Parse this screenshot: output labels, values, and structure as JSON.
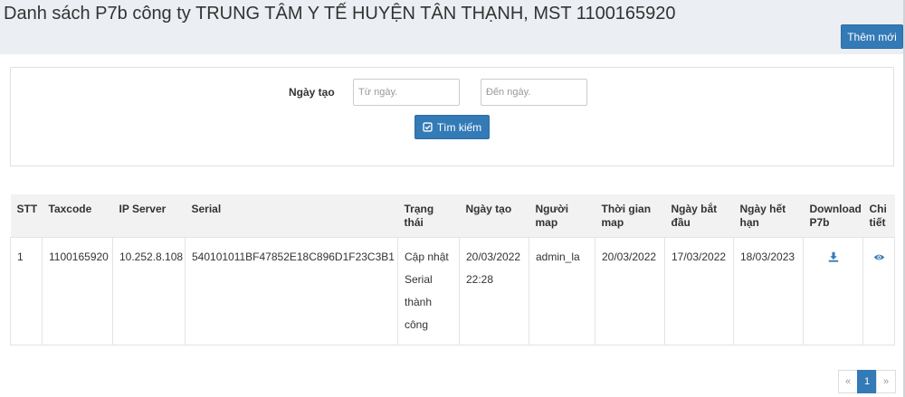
{
  "header": {
    "title": "Danh sách P7b công ty TRUNG TÂM Y TẾ HUYỆN TÂN THẠNH, MST 1100165920",
    "add_button": "Thêm mới"
  },
  "filter": {
    "label": "Ngày tạo",
    "from_placeholder": "Từ ngày.",
    "to_placeholder": "Đến ngày.",
    "search_button": "Tìm kiếm",
    "search_icon": "check-square-icon"
  },
  "table": {
    "headers": [
      "STT",
      "Taxcode",
      "IP Server",
      "Serial",
      "Trạng thái",
      "Ngày tạo",
      "Người map",
      "Thời gian map",
      "Ngày bắt đầu",
      "Ngày hết hạn",
      "Download P7b",
      "Chi tiết"
    ],
    "rows": [
      {
        "stt": "1",
        "taxcode": "1100165920",
        "ip_server": "10.252.8.108",
        "serial": "540101011BF47852E18C896D1F23C3B1",
        "status": "Cập nhật Serial thành công",
        "created": "20/03/2022 22:28",
        "mapper": "admin_la",
        "map_time": "20/03/2022",
        "start_date": "17/03/2022",
        "end_date": "18/03/2023",
        "download_icon": "download-icon",
        "detail_icon": "eye-icon"
      }
    ]
  },
  "pagination": {
    "prev": "«",
    "current": "1",
    "next": "»"
  },
  "colors": {
    "primary": "#337ab7",
    "header_bg": "#ebeef2"
  }
}
